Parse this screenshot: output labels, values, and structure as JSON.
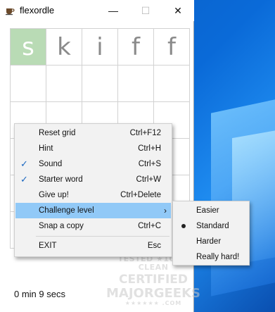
{
  "window": {
    "title": "flexordle",
    "minimize": "—",
    "maximize": "☐",
    "close": "✕"
  },
  "grid": {
    "rows": [
      [
        {
          "letter": "s",
          "state": "correct"
        },
        {
          "letter": "k",
          "state": "none"
        },
        {
          "letter": "i",
          "state": "none"
        },
        {
          "letter": "f",
          "state": "none"
        },
        {
          "letter": "f",
          "state": "none"
        }
      ],
      [
        {
          "letter": "",
          "state": "empty"
        },
        {
          "letter": "",
          "state": "empty"
        },
        {
          "letter": "",
          "state": "empty"
        },
        {
          "letter": "",
          "state": "empty"
        },
        {
          "letter": "",
          "state": "empty"
        }
      ],
      [
        {
          "letter": "",
          "state": "empty"
        },
        {
          "letter": "",
          "state": "empty"
        },
        {
          "letter": "",
          "state": "empty"
        },
        {
          "letter": "",
          "state": "empty"
        },
        {
          "letter": "",
          "state": "empty"
        }
      ],
      [
        {
          "letter": "",
          "state": "empty"
        },
        {
          "letter": "",
          "state": "empty"
        },
        {
          "letter": "",
          "state": "empty"
        },
        {
          "letter": "",
          "state": "empty"
        },
        {
          "letter": "",
          "state": "empty"
        }
      ],
      [
        {
          "letter": "",
          "state": "empty"
        },
        {
          "letter": "",
          "state": "empty"
        },
        {
          "letter": "",
          "state": "empty"
        },
        {
          "letter": "",
          "state": "empty"
        },
        {
          "letter": "",
          "state": "empty"
        }
      ],
      [
        {
          "letter": "",
          "state": "empty"
        },
        {
          "letter": "",
          "state": "empty"
        },
        {
          "letter": "",
          "state": "empty"
        },
        {
          "letter": "",
          "state": "empty"
        },
        {
          "letter": "",
          "state": "empty"
        }
      ]
    ],
    "correct_color": "#b9dbb5"
  },
  "timer": "0 min 9 secs",
  "menu": {
    "items": [
      {
        "label": "Reset grid",
        "shortcut": "Ctrl+F12",
        "checked": false
      },
      {
        "label": "Hint",
        "shortcut": "Ctrl+H",
        "checked": false
      },
      {
        "label": "Sound",
        "shortcut": "Ctrl+S",
        "checked": true
      },
      {
        "label": "Starter word",
        "shortcut": "Ctrl+W",
        "checked": true
      },
      {
        "label": "Give up!",
        "shortcut": "Ctrl+Delete",
        "checked": false
      },
      {
        "label": "Challenge level",
        "shortcut": "",
        "checked": false,
        "highlighted": true,
        "submenu": true
      },
      {
        "label": "Snap a copy",
        "shortcut": "Ctrl+C",
        "checked": false
      },
      {
        "label": "EXIT",
        "shortcut": "Esc",
        "checked": false
      }
    ],
    "check_glyph": "✓",
    "submenu_arrow": "›",
    "highlight_color": "#91c9f7"
  },
  "submenu": {
    "items": [
      {
        "label": "Easier",
        "selected": false
      },
      {
        "label": "Standard",
        "selected": true
      },
      {
        "label": "Harder",
        "selected": false
      },
      {
        "label": "Really hard!",
        "selected": false
      }
    ]
  },
  "watermark": {
    "line1": "TESTED ★100% CLEAN",
    "line2": "CERTIFIED",
    "line3": "MAJORGEEKS",
    "line4": "★★★★★★ .COM"
  },
  "icons": {
    "app": "coffee-cup-icon",
    "check": "checkmark-icon",
    "submenu_arrow": "chevron-right-icon",
    "radio": "radio-dot-icon"
  }
}
